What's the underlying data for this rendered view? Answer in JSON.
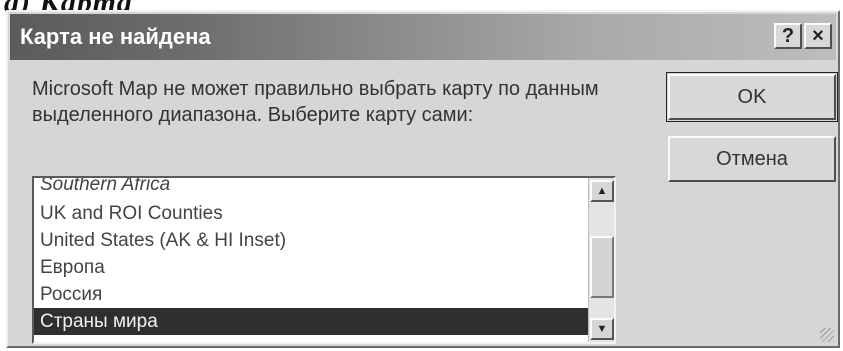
{
  "page_caption": "а) Карта",
  "dialog": {
    "title": "Карта не найдена",
    "help_label": "?",
    "close_label": "×",
    "message": "Microsoft Map не может правильно выбрать карту по данным выделенного диапазона. Выберите карту сами:",
    "ok_label": "OK",
    "cancel_label": "Отмена"
  },
  "map_list": {
    "items": [
      "Southern Africa",
      "UK and ROI Counties",
      "United States (AK & HI Inset)",
      "Европа",
      "Россия",
      "Страны мира"
    ],
    "selected": "Страны мира"
  },
  "scrollbar": {
    "up_arrow": "▲",
    "down_arrow": "▼"
  }
}
